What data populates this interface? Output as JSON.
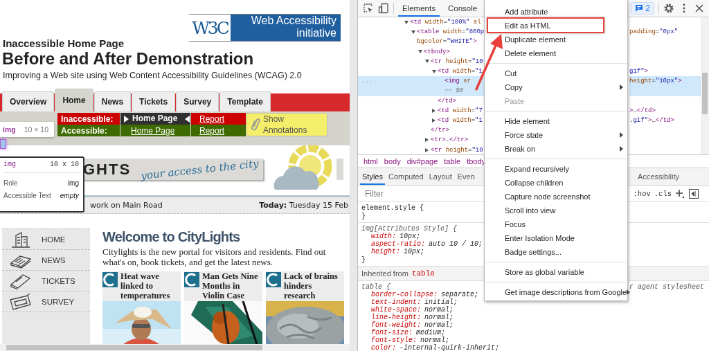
{
  "browser_page": {
    "logo": {
      "mark": "W3C",
      "line_1": "Web Accessibility",
      "line_2": "initiative"
    },
    "subtitle": "Inaccessible Home Page",
    "title": "Before and After Demonstration",
    "tagline": "Improving a Web site using Web Content Accessibility Guidelines (WCAG) 2.0",
    "tabs": [
      {
        "label": "Overview",
        "selected": false
      },
      {
        "label": "Home",
        "selected": true
      },
      {
        "label": "News",
        "selected": false
      },
      {
        "label": "Tickets",
        "selected": false
      },
      {
        "label": "Survey",
        "selected": false
      },
      {
        "label": "Template",
        "selected": false
      }
    ],
    "versions": [
      {
        "kind": "inaccessible",
        "label": "Inaccessible:",
        "page": "Home Page",
        "report": "Report",
        "current": true
      },
      {
        "kind": "accessible",
        "label": "Accessible:",
        "page": "Home Page",
        "report": "Report",
        "current": false
      }
    ],
    "annotations_button": "Show Annotations",
    "banner": {
      "name": "GHTS",
      "slogan": "your access to the city"
    },
    "ticker": {
      "news": "work on Main Road",
      "date_label": "Today:",
      "date": "Tuesday 15 Feb"
    },
    "nav": [
      {
        "kind": "building",
        "label": "HOME"
      },
      {
        "kind": "newspaper",
        "label": "NEWS"
      },
      {
        "kind": "ticket",
        "label": "TICKETS"
      },
      {
        "kind": "clipboard",
        "label": "SURVEY"
      }
    ],
    "welcome": {
      "heading": "Welcome to CityLights",
      "text": "Citylights is the new portal for visitors and residents. Find out what's on, book tickets, and get the latest news."
    },
    "news": [
      {
        "title": "Heat wave linked to temperatures",
        "kind": "picture"
      },
      {
        "title": "Man Gets Nine Months in Violin Case",
        "kind": "picture"
      },
      {
        "title": "Lack of brains hinders research",
        "kind": "picture"
      }
    ]
  },
  "element_badge": {
    "tag": "img",
    "size": "10 × 10"
  },
  "inspector_tooltip": {
    "tag": "img",
    "size": "10 x 10",
    "rows": [
      {
        "label": "Role",
        "value": "img",
        "italic": false
      },
      {
        "label": "Accessible Text",
        "value": "empty",
        "italic": true
      }
    ]
  },
  "devtools": {
    "tabs": [
      {
        "label": "Elements",
        "selected": true
      },
      {
        "label": "Console",
        "selected": false
      }
    ],
    "issues_count": "2",
    "dom_tree": [
      {
        "kind": "element",
        "text": "<td width=\"100%\" al",
        "expanded": true,
        "selected": false,
        "children": [
          {
            "kind": "element",
            "text": "<table width=\"800p",
            "right": "padding=\"0px\"",
            "continuation": "bgcolor=\"WHITE\">",
            "expanded": true,
            "selected": false,
            "children": [
              {
                "kind": "element",
                "text": "<tbody>",
                "expanded": true,
                "selected": false,
                "children": [
                  {
                    "kind": "element",
                    "text": "<tr height=\"10",
                    "expanded": true,
                    "selected": false,
                    "children": [
                      {
                        "kind": "element",
                        "text": "<td width=\"1",
                        "right": "gif\">",
                        "expanded": true,
                        "selected": false,
                        "children": [
                          {
                            "kind": "leaf",
                            "text": "<img sr",
                            "right": "height=\"10px\">",
                            "continuation": "== $0",
                            "gutter": "...",
                            "selected": true
                          }
                        ]
                      },
                      {
                        "kind": "closing",
                        "text": "</td>",
                        "selected": false
                      },
                      {
                        "kind": "element",
                        "text": "<td width=\"7",
                        "right": ">…</td>",
                        "expanded": false,
                        "selected": false
                      },
                      {
                        "kind": "element",
                        "text": "<td width=\"1",
                        "right": ".gif\">…</td>",
                        "expanded": false,
                        "selected": false
                      }
                    ]
                  },
                  {
                    "kind": "closing",
                    "text": "</tr>",
                    "selected": false
                  },
                  {
                    "kind": "element",
                    "text": "<tr>…</tr>",
                    "expanded": false,
                    "selected": false
                  },
                  {
                    "kind": "element",
                    "text": "<tr height=\"10",
                    "expanded": false,
                    "selected": false
                  }
                ]
              }
            ]
          }
        ]
      }
    ],
    "breadcrumbs": [
      "html",
      "body",
      "div#page",
      "table",
      "tbody"
    ],
    "styles_tabs": [
      {
        "label": "Styles",
        "selected": true
      },
      {
        "label": "Computed",
        "selected": false
      },
      {
        "label": "Layout",
        "selected": false
      },
      {
        "label": "Even",
        "selected": false
      },
      {
        "label": "Accessibility",
        "selected": false
      }
    ],
    "filter": {
      "placeholder": "Filter"
    },
    "style_toggles": [
      ":hov",
      ".cls"
    ],
    "rules": [
      {
        "kind": "rule",
        "selector": "element.style {",
        "italic": false,
        "close": "}"
      },
      {
        "kind": "rule",
        "selector": "img[Attributes Style] {",
        "italic": true,
        "close": "}",
        "declarations": [
          {
            "property": "width:",
            "value": "10px;"
          },
          {
            "property": "aspect-ratio:",
            "value": "auto 10 / 10;"
          },
          {
            "property": "height:",
            "value": "10px;"
          }
        ]
      },
      {
        "kind": "inherited",
        "label": "Inherited from",
        "tag": "table"
      },
      {
        "kind": "rule",
        "selector": "table {",
        "italic": true,
        "source": "r agent stylesheet",
        "declarations": [
          {
            "property": "border-collapse:",
            "value": "separate;"
          },
          {
            "property": "text-indent:",
            "value": "initial;"
          },
          {
            "property": "white-space:",
            "value": "normal;"
          },
          {
            "property": "line-height:",
            "value": "normal;"
          },
          {
            "property": "font-weight:",
            "value": "normal;"
          },
          {
            "property": "font-size:",
            "value": "medium;"
          },
          {
            "property": "font-style:",
            "value": "normal;"
          },
          {
            "property": "color:",
            "value": "-internal-quirk-inherit;"
          }
        ]
      }
    ]
  },
  "context_menu": {
    "groups": [
      [
        {
          "label": "Add attribute",
          "submenu": false,
          "disabled": false,
          "highlighted": false
        },
        {
          "label": "Edit as HTML",
          "submenu": false,
          "disabled": false,
          "highlighted": true
        },
        {
          "label": "Duplicate element",
          "submenu": false,
          "disabled": false,
          "highlighted": false
        },
        {
          "label": "Delete element",
          "submenu": false,
          "disabled": false,
          "highlighted": false
        }
      ],
      [
        {
          "label": "Cut",
          "submenu": false,
          "disabled": false,
          "highlighted": false
        },
        {
          "label": "Copy",
          "submenu": true,
          "disabled": false,
          "highlighted": false
        },
        {
          "label": "Paste",
          "submenu": false,
          "disabled": true,
          "highlighted": false
        }
      ],
      [
        {
          "label": "Hide element",
          "submenu": false,
          "disabled": false,
          "highlighted": false
        },
        {
          "label": "Force state",
          "submenu": true,
          "disabled": false,
          "highlighted": false
        },
        {
          "label": "Break on",
          "submenu": true,
          "disabled": false,
          "highlighted": false
        }
      ],
      [
        {
          "label": "Expand recursively",
          "submenu": false,
          "disabled": false,
          "highlighted": false
        },
        {
          "label": "Collapse children",
          "submenu": false,
          "disabled": false,
          "highlighted": false
        },
        {
          "label": "Capture node screenshot",
          "submenu": false,
          "disabled": false,
          "highlighted": false
        },
        {
          "label": "Scroll into view",
          "submenu": false,
          "disabled": false,
          "highlighted": false
        },
        {
          "label": "Focus",
          "submenu": false,
          "disabled": false,
          "highlighted": false
        },
        {
          "label": "Enter Isolation Mode",
          "submenu": false,
          "disabled": false,
          "highlighted": false
        },
        {
          "label": "Badge settings...",
          "submenu": false,
          "disabled": false,
          "highlighted": false
        }
      ],
      [
        {
          "label": "Store as global variable",
          "submenu": false,
          "disabled": false,
          "highlighted": false
        }
      ],
      [
        {
          "label": "Get image descriptions from Google",
          "submenu": true,
          "disabled": false,
          "highlighted": false
        }
      ]
    ]
  }
}
